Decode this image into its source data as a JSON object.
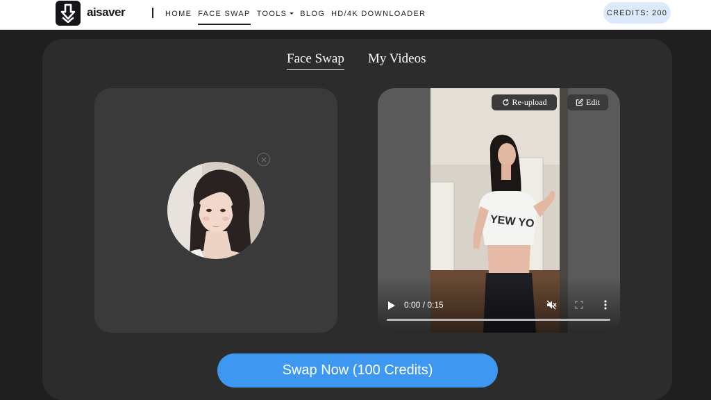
{
  "header": {
    "logo_text": "aisaver",
    "logo_icon": "download-arrow-icon",
    "nav": [
      {
        "label": "HOME",
        "active": false
      },
      {
        "label": "FACE SWAP",
        "active": true
      },
      {
        "label": "TOOLS",
        "active": false,
        "has_dropdown": true
      },
      {
        "label": "BLOG",
        "active": false
      },
      {
        "label": "HD/4K DOWNLOADER",
        "active": false
      }
    ],
    "credits_label": "CREDITS: 200"
  },
  "tabs": {
    "face_swap": "Face Swap",
    "my_videos": "My Videos",
    "active": "face_swap"
  },
  "face_upload": {
    "remove_icon": "close-circle-icon"
  },
  "video": {
    "reupload_label": "Re-upload",
    "edit_label": "Edit",
    "time": "0:00 / 0:15",
    "progress": 0,
    "muted": true
  },
  "actions": {
    "swap_label": "Swap Now (100 Credits)"
  },
  "colors": {
    "accent": "#3e98f1",
    "credits_bg": "#dce9fb",
    "panel_bg": "#2c2c2c",
    "page_bg": "#1f1f1f"
  }
}
